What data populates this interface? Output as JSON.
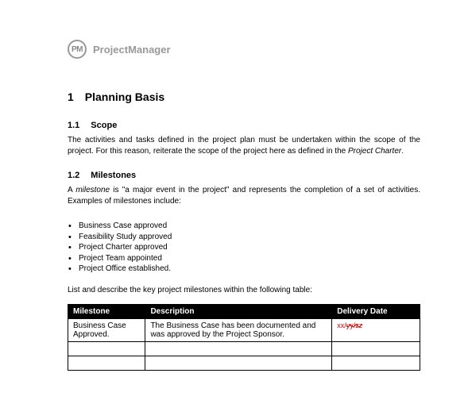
{
  "brand": {
    "icon_text": "PM",
    "label": "ProjectManager"
  },
  "section1": {
    "num": "1",
    "title": "Planning Basis"
  },
  "scope": {
    "num": "1.1",
    "title": "Scope",
    "text_pre": "The activities and tasks defined in the project plan must be undertaken within the scope of the project. For this reason, reiterate the scope of the project here as defined in the ",
    "text_italic": "Project Charter",
    "text_post": "."
  },
  "milestones": {
    "num": "1.2",
    "title": "Milestones",
    "intro_pre": "A ",
    "intro_italic": "milestone",
    "intro_post": " is \"a major event in the project\" and represents the completion of a set of activities. Examples of milestones include:",
    "bullets": [
      "Business Case approved",
      "Feasibility Study approved",
      "Project Charter approved",
      "Project Team appointed",
      "Project Office established."
    ],
    "table_intro": "List and describe the key project milestones within the following table:"
  },
  "table": {
    "headers": {
      "milestone": "Milestone",
      "description": "Description",
      "delivery": "Delivery Date"
    },
    "rows": [
      {
        "milestone": "Business Case Approved.",
        "description": "The Business Case has been documented and was approved by the Project Sponsor.",
        "date_pre": "xx/",
        "date_strike": "yy/zz"
      },
      {
        "milestone": "",
        "description": "",
        "date_pre": "",
        "date_strike": ""
      },
      {
        "milestone": "",
        "description": "",
        "date_pre": "",
        "date_strike": ""
      }
    ]
  }
}
